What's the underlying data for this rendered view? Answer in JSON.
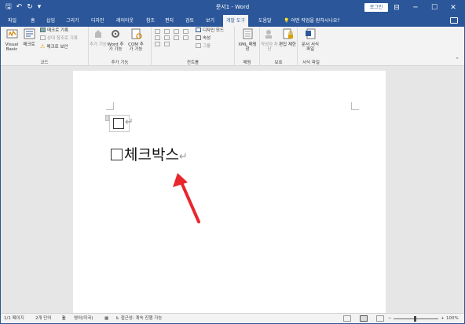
{
  "window": {
    "title": "문서1 - Word",
    "login_label": "로그인",
    "qat": {
      "save": "🖫",
      "undo": "↶",
      "redo": "↻",
      "customize": "▾"
    },
    "controls": {
      "ribbon_display": "⊟",
      "minimize": "─",
      "maximize": "☐",
      "close": "✕"
    }
  },
  "tabs": [
    "파일",
    "홈",
    "삽입",
    "그리기",
    "디자인",
    "레이아웃",
    "참조",
    "편지",
    "검토",
    "보기",
    "개발 도구",
    "도움말"
  ],
  "active_tab": "개발 도구",
  "tell_me": "어떤 작업을 원하시나요?",
  "ribbon": {
    "code": {
      "label": "코드",
      "visual_basic": "Visual Basic",
      "macro": "매크로",
      "record_macro": "매크로 기록",
      "relative_ref": "상대 참조로 기록",
      "macro_security": "매크로 보안"
    },
    "addins": {
      "label": "추가 기능",
      "addins": "추가 기능",
      "word_addins": "Word 추가 기능",
      "com_addins": "COM 추가 기능"
    },
    "controls": {
      "label": "컨트롤",
      "design_mode": "디자인 모드",
      "properties": "속성",
      "group": "그룹"
    },
    "mapping": {
      "label": "매핑",
      "xml_pane": "XML 매핑 창"
    },
    "protect": {
      "label": "보호",
      "block_authors": "작성자 차단",
      "restrict_editing": "편집 제한"
    },
    "templates": {
      "label": "서식 파일",
      "document_template": "문서 서식 파일"
    }
  },
  "document": {
    "line1_box": "☐",
    "line2_box": "☐",
    "line2_text": "체크박스",
    "para_mark": "↵"
  },
  "status": {
    "page": "1/1 페이지",
    "words": "2개 단어",
    "language": "영어(미국)",
    "accessibility": "접근성: 계속 진행 가능",
    "zoom": "100%",
    "zoom_minus": "−",
    "zoom_plus": "+"
  },
  "colors": {
    "accent": "#2b579a",
    "arrow": "#e8262b"
  }
}
